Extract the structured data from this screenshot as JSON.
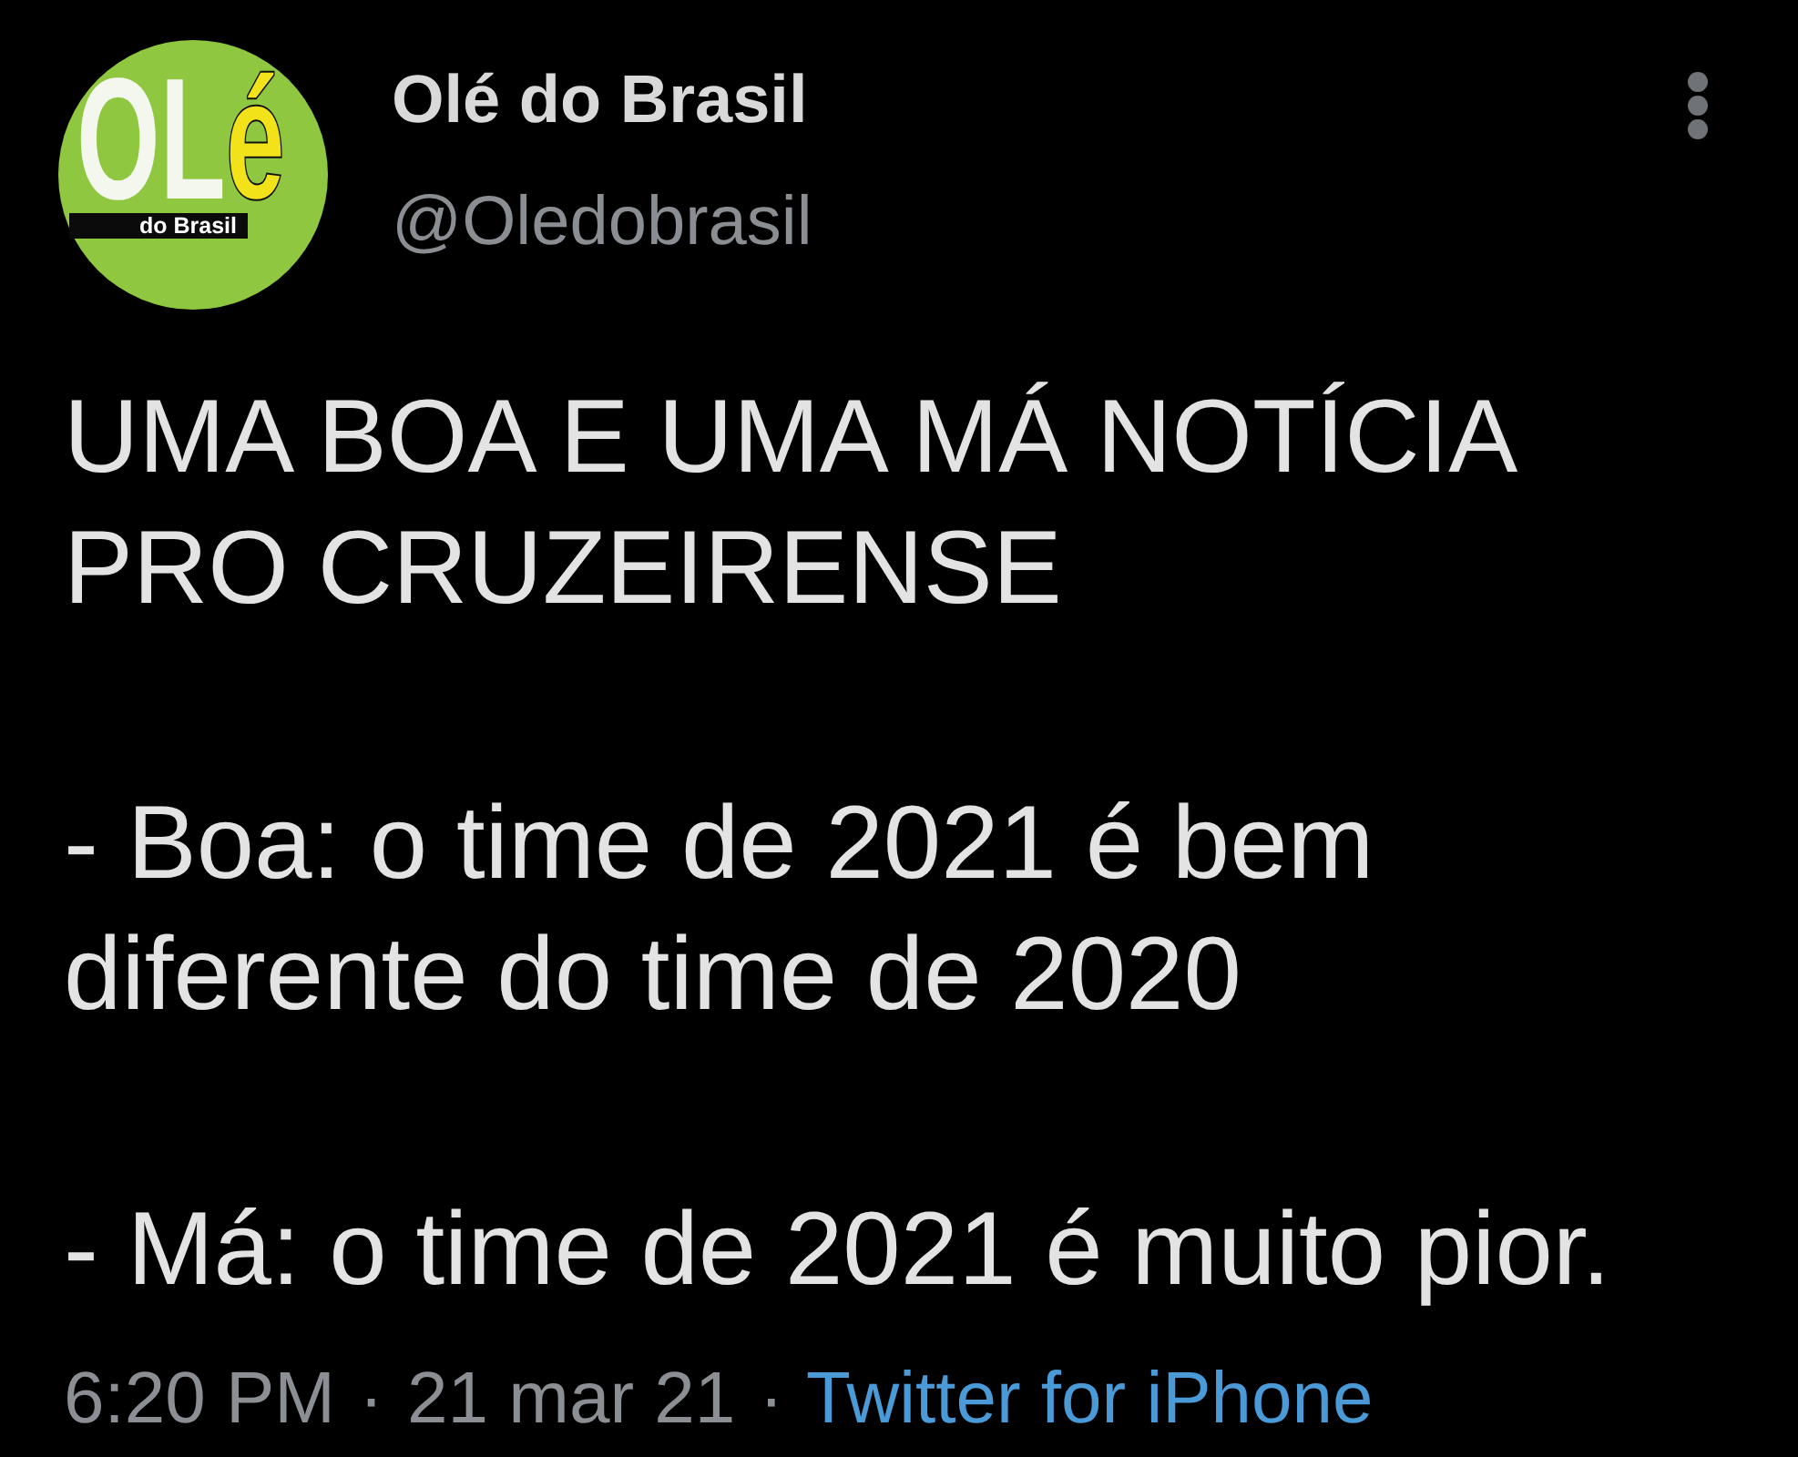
{
  "author": {
    "logo": {
      "letters": "OL",
      "accent_letter": "é",
      "tagline": "do Brasil"
    },
    "name": "Olé do Brasil",
    "handle": "@Oledobrasil"
  },
  "tweet": {
    "paragraphs": [
      "UMA BOA E UMA MÁ NOTÍCIA PRO CRUZEIRENSE",
      "- Boa: o time de 2021 é bem diferente do time de 2020",
      "- Má: o time de 2021 é muito pior."
    ]
  },
  "meta": {
    "time": "6:20 PM",
    "date": "21 mar 21",
    "source": "Twitter for iPhone",
    "separators": [
      "·",
      "·"
    ]
  }
}
